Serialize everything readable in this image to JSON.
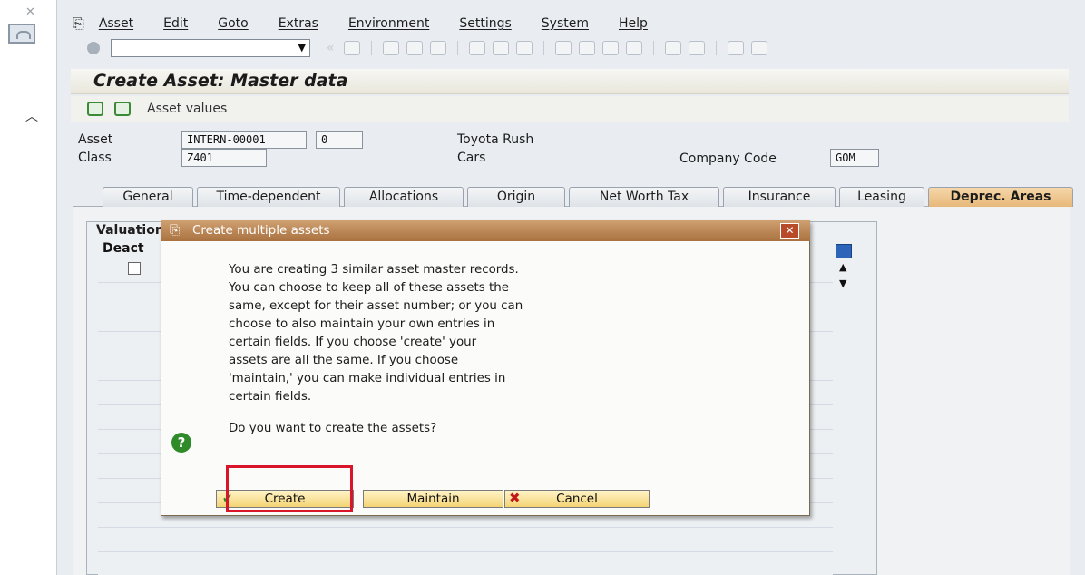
{
  "menu": {
    "items": [
      "Asset",
      "Edit",
      "Goto",
      "Extras",
      "Environment",
      "Settings",
      "System",
      "Help"
    ]
  },
  "toolbar": {
    "command_field_value": ""
  },
  "page": {
    "title": "Create Asset:  Master data",
    "asset_values_button": "Asset values"
  },
  "header": {
    "asset_label": "Asset",
    "asset_number": "INTERN-00001",
    "asset_subnumber": "0",
    "asset_description": "Toyota Rush",
    "class_label": "Class",
    "class_value": "Z401",
    "class_description": "Cars",
    "company_code_label": "Company Code",
    "company_code_value": "GOM"
  },
  "tabs": [
    {
      "label": "General",
      "active": false
    },
    {
      "label": "Time-dependent",
      "active": false
    },
    {
      "label": "Allocations",
      "active": false
    },
    {
      "label": "Origin",
      "active": false
    },
    {
      "label": "Net Worth Tax",
      "active": false
    },
    {
      "label": "Insurance",
      "active": false
    },
    {
      "label": "Leasing",
      "active": false
    },
    {
      "label": "Deprec. Areas",
      "active": true
    }
  ],
  "table": {
    "group_title": "Valuatior",
    "deact_column": "Deact"
  },
  "dialog": {
    "title": "Create multiple assets",
    "message": "You are creating 3 similar asset master records.\nYou can choose to keep all of these assets the\nsame, except for their asset number; or you can\nchoose to also maintain your own entries in\ncertain fields. If you choose 'create' your\nassets are all the same. If you choose\n'maintain,' you can make individual entries in\ncertain fields.",
    "question": "Do you want to create the assets?",
    "create_label": "Create",
    "maintain_label": "Maintain",
    "cancel_label": "Cancel"
  },
  "colors": {
    "dialog_title_bar": "#a9713f",
    "active_tab": "#e7b87a",
    "highlight_box": "#d8152a",
    "button_fill": "#f4d474"
  }
}
